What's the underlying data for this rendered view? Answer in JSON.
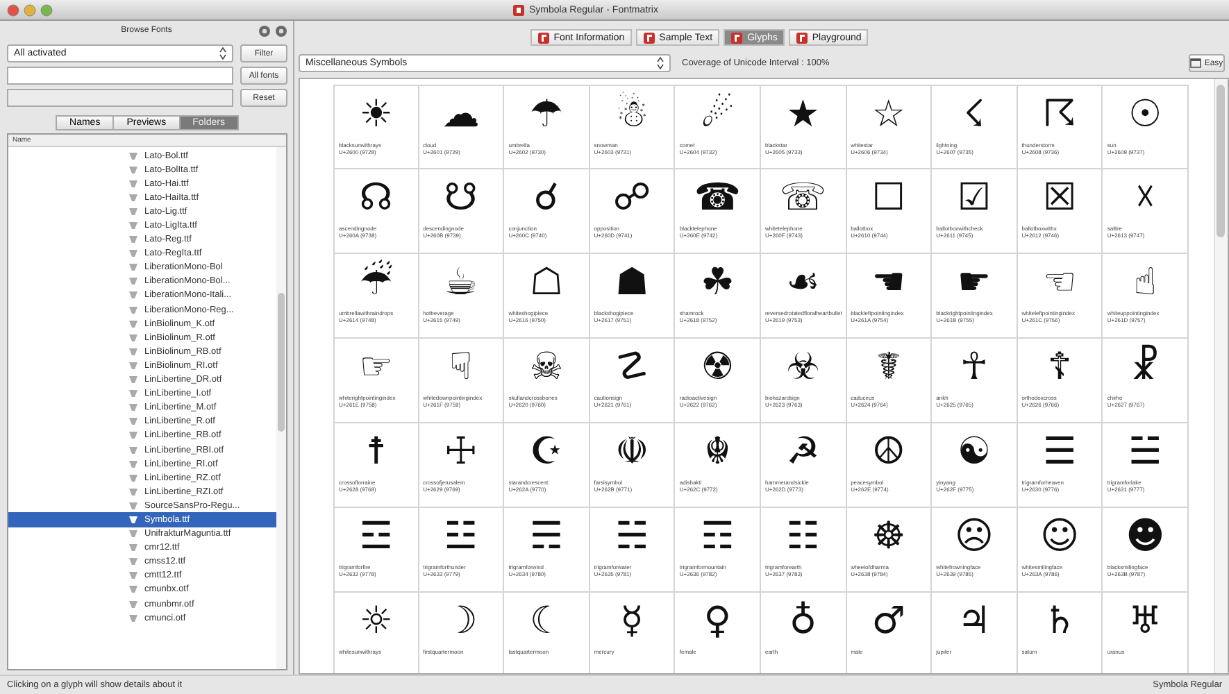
{
  "window": {
    "title": "Symbola Regular - Fontmatrix"
  },
  "browser": {
    "title": "Browse Fonts",
    "filter_select": "All activated",
    "buttons": [
      "Filter",
      "All fonts",
      "Reset"
    ],
    "tabs": [
      {
        "label": "Names",
        "selected": false
      },
      {
        "label": "Previews",
        "selected": false
      },
      {
        "label": "Folders",
        "selected": true
      }
    ],
    "list_header": "Name",
    "files": [
      {
        "name": "Lato-Bol.ttf",
        "selected": false
      },
      {
        "name": "Lato-BolIta.ttf",
        "selected": false
      },
      {
        "name": "Lato-Hai.ttf",
        "selected": false
      },
      {
        "name": "Lato-HaiIta.ttf",
        "selected": false
      },
      {
        "name": "Lato-Lig.ttf",
        "selected": false
      },
      {
        "name": "Lato-LigIta.ttf",
        "selected": false
      },
      {
        "name": "Lato-Reg.ttf",
        "selected": false
      },
      {
        "name": "Lato-RegIta.ttf",
        "selected": false
      },
      {
        "name": "LiberationMono-Bol",
        "selected": false
      },
      {
        "name": "LiberationMono-Bol...",
        "selected": false
      },
      {
        "name": "LiberationMono-Itali...",
        "selected": false
      },
      {
        "name": "LiberationMono-Reg...",
        "selected": false
      },
      {
        "name": "LinBiolinum_K.otf",
        "selected": false
      },
      {
        "name": "LinBiolinum_R.otf",
        "selected": false
      },
      {
        "name": "LinBiolinum_RB.otf",
        "selected": false
      },
      {
        "name": "LinBiolinum_RI.otf",
        "selected": false
      },
      {
        "name": "LinLibertine_DR.otf",
        "selected": false
      },
      {
        "name": "LinLibertine_I.otf",
        "selected": false
      },
      {
        "name": "LinLibertine_M.otf",
        "selected": false
      },
      {
        "name": "LinLibertine_R.otf",
        "selected": false
      },
      {
        "name": "LinLibertine_RB.otf",
        "selected": false
      },
      {
        "name": "LinLibertine_RBI.otf",
        "selected": false
      },
      {
        "name": "LinLibertine_RI.otf",
        "selected": false
      },
      {
        "name": "LinLibertine_RZ.otf",
        "selected": false
      },
      {
        "name": "LinLibertine_RZI.otf",
        "selected": false
      },
      {
        "name": "SourceSansPro-Regu...",
        "selected": false
      },
      {
        "name": "Symbola.ttf",
        "selected": true
      },
      {
        "name": "UnifrakturMaguntia.ttf",
        "selected": false
      },
      {
        "name": "cmr12.ttf",
        "selected": false
      },
      {
        "name": "cmss12.ttf",
        "selected": false
      },
      {
        "name": "cmtt12.ttf",
        "selected": false
      },
      {
        "name": "cmunbx.otf",
        "selected": false
      },
      {
        "name": "cmunbmr.otf",
        "selected": false
      },
      {
        "name": "cmunci.otf",
        "selected": false
      }
    ]
  },
  "tabs": [
    {
      "label": "Font Information",
      "selected": false
    },
    {
      "label": "Sample Text",
      "selected": false
    },
    {
      "label": "Glyphs",
      "selected": true
    },
    {
      "label": "Playground",
      "selected": false
    }
  ],
  "toolbar": {
    "block_select": "Miscellaneous Symbols",
    "coverage": "Coverage of Unicode Interval : 100%",
    "easy_button": "Easy"
  },
  "glyphs": [
    {
      "glyph": "☀",
      "name": "blacksunwithrays",
      "code": "U+2600 (9728)"
    },
    {
      "glyph": "☁",
      "name": "cloud",
      "code": "U+2601 (9729)"
    },
    {
      "glyph": "☂",
      "name": "umbrella",
      "code": "U+2602 (9730)"
    },
    {
      "glyph": "☃",
      "name": "snowman",
      "code": "U+2603 (9731)"
    },
    {
      "glyph": "☄",
      "name": "comet",
      "code": "U+2604 (9732)"
    },
    {
      "glyph": "★",
      "name": "blackstar",
      "code": "U+2605 (9733)"
    },
    {
      "glyph": "☆",
      "name": "whitestar",
      "code": "U+2606 (9734)"
    },
    {
      "glyph": "☇",
      "name": "lightning",
      "code": "U+2607 (9735)"
    },
    {
      "glyph": "☈",
      "name": "thunderstorm",
      "code": "U+2608 (9736)"
    },
    {
      "glyph": "☉",
      "name": "sun",
      "code": "U+2609 (9737)"
    },
    {
      "glyph": "☊",
      "name": "ascendingnode",
      "code": "U+260A (9738)"
    },
    {
      "glyph": "☋",
      "name": "descendingnode",
      "code": "U+260B (9739)"
    },
    {
      "glyph": "☌",
      "name": "conjunction",
      "code": "U+260C (9740)"
    },
    {
      "glyph": "☍",
      "name": "opposition",
      "code": "U+260D (9741)"
    },
    {
      "glyph": "☎",
      "name": "blacktelephone",
      "code": "U+260E (9742)"
    },
    {
      "glyph": "☏",
      "name": "whitetelephone",
      "code": "U+260F (9743)"
    },
    {
      "glyph": "☐",
      "name": "ballotbox",
      "code": "U+2610 (9744)"
    },
    {
      "glyph": "☑",
      "name": "ballotboxwithcheck",
      "code": "U+2611 (9745)"
    },
    {
      "glyph": "☒",
      "name": "ballotboxwithx",
      "code": "U+2612 (9746)"
    },
    {
      "glyph": "☓",
      "name": "saltire",
      "code": "U+2613 (9747)"
    },
    {
      "glyph": "☔",
      "name": "umbrellawithraindrops",
      "code": "U+2614 (9748)"
    },
    {
      "glyph": "☕",
      "name": "hotbeverage",
      "code": "U+2615 (9749)"
    },
    {
      "glyph": "☖",
      "name": "whiteshogipiece",
      "code": "U+2616 (9750)"
    },
    {
      "glyph": "☗",
      "name": "blackshogipiece",
      "code": "U+2617 (9751)"
    },
    {
      "glyph": "☘",
      "name": "shamrock",
      "code": "U+2618 (9752)"
    },
    {
      "glyph": "☙",
      "name": "reversedrotatedfloralheartbullet",
      "code": "U+2619 (9753)"
    },
    {
      "glyph": "☚",
      "name": "blackleftpointingindex",
      "code": "U+261A (9754)"
    },
    {
      "glyph": "☛",
      "name": "blackrightpointingindex",
      "code": "U+261B (9755)"
    },
    {
      "glyph": "☜",
      "name": "whiteleftpointingindex",
      "code": "U+261C (9756)"
    },
    {
      "glyph": "☝",
      "name": "whiteuppointingindex",
      "code": "U+261D (9757)"
    },
    {
      "glyph": "☞",
      "name": "whiterightpointingindex",
      "code": "U+261E (9758)"
    },
    {
      "glyph": "☟",
      "name": "whitedownpointingindex",
      "code": "U+261F (9759)"
    },
    {
      "glyph": "☠",
      "name": "skullandcrossbones",
      "code": "U+2620 (9760)"
    },
    {
      "glyph": "☡",
      "name": "cautionsign",
      "code": "U+2621 (9761)"
    },
    {
      "glyph": "☢",
      "name": "radioactivesign",
      "code": "U+2622 (9762)"
    },
    {
      "glyph": "☣",
      "name": "biohazardsign",
      "code": "U+2623 (9763)"
    },
    {
      "glyph": "☤",
      "name": "caduceus",
      "code": "U+2624 (9764)"
    },
    {
      "glyph": "☥",
      "name": "ankh",
      "code": "U+2625 (9765)"
    },
    {
      "glyph": "☦",
      "name": "orthodoxcross",
      "code": "U+2626 (9766)"
    },
    {
      "glyph": "☧",
      "name": "chirho",
      "code": "U+2627 (9767)"
    },
    {
      "glyph": "☨",
      "name": "crossoflorraine",
      "code": "U+2628 (9768)"
    },
    {
      "glyph": "☩",
      "name": "crossofjerusalem",
      "code": "U+2629 (9769)"
    },
    {
      "glyph": "☪",
      "name": "starandcrescent",
      "code": "U+262A (9770)"
    },
    {
      "glyph": "☫",
      "name": "farsisymbol",
      "code": "U+262B (9771)"
    },
    {
      "glyph": "☬",
      "name": "adishakti",
      "code": "U+262C (9772)"
    },
    {
      "glyph": "☭",
      "name": "hammerandsickle",
      "code": "U+262D (9773)"
    },
    {
      "glyph": "☮",
      "name": "peacesymbol",
      "code": "U+262E (9774)"
    },
    {
      "glyph": "☯",
      "name": "yinyang",
      "code": "U+262F (9775)"
    },
    {
      "glyph": "☰",
      "name": "trigramforheaven",
      "code": "U+2630 (9776)"
    },
    {
      "glyph": "☱",
      "name": "trigramforlake",
      "code": "U+2631 (9777)"
    },
    {
      "glyph": "☲",
      "name": "trigramforfire",
      "code": "U+2632 (9778)"
    },
    {
      "glyph": "☳",
      "name": "trigramforthunder",
      "code": "U+2633 (9779)"
    },
    {
      "glyph": "☴",
      "name": "trigramforwind",
      "code": "U+2634 (9780)"
    },
    {
      "glyph": "☵",
      "name": "trigramforwater",
      "code": "U+2635 (9781)"
    },
    {
      "glyph": "☶",
      "name": "trigramformountain",
      "code": "U+2636 (9782)"
    },
    {
      "glyph": "☷",
      "name": "trigramforearth",
      "code": "U+2637 (9783)"
    },
    {
      "glyph": "☸",
      "name": "wheelofdharma",
      "code": "U+2638 (9784)"
    },
    {
      "glyph": "☹",
      "name": "whitefrowningface",
      "code": "U+2639 (9785)"
    },
    {
      "glyph": "☺",
      "name": "whitesmilingface",
      "code": "U+263A (9786)"
    },
    {
      "glyph": "☻",
      "name": "blacksmilingface",
      "code": "U+263B (9787)"
    },
    {
      "glyph": "☼",
      "name": "whitesunwithrays"
    },
    {
      "glyph": "☽",
      "name": "firstquartermoon"
    },
    {
      "glyph": "☾",
      "name": "lastquartermoon"
    },
    {
      "glyph": "☿",
      "name": "mercury"
    },
    {
      "glyph": "♀",
      "name": "female"
    },
    {
      "glyph": "♁",
      "name": "earth"
    },
    {
      "glyph": "♂",
      "name": "male"
    },
    {
      "glyph": "♃",
      "name": "jupiter"
    },
    {
      "glyph": "♄",
      "name": "saturn"
    },
    {
      "glyph": "♅",
      "name": "uranus"
    }
  ],
  "status_bar": {
    "message": "Clicking on a glyph will show details about it",
    "font": "Symbola Regular"
  }
}
